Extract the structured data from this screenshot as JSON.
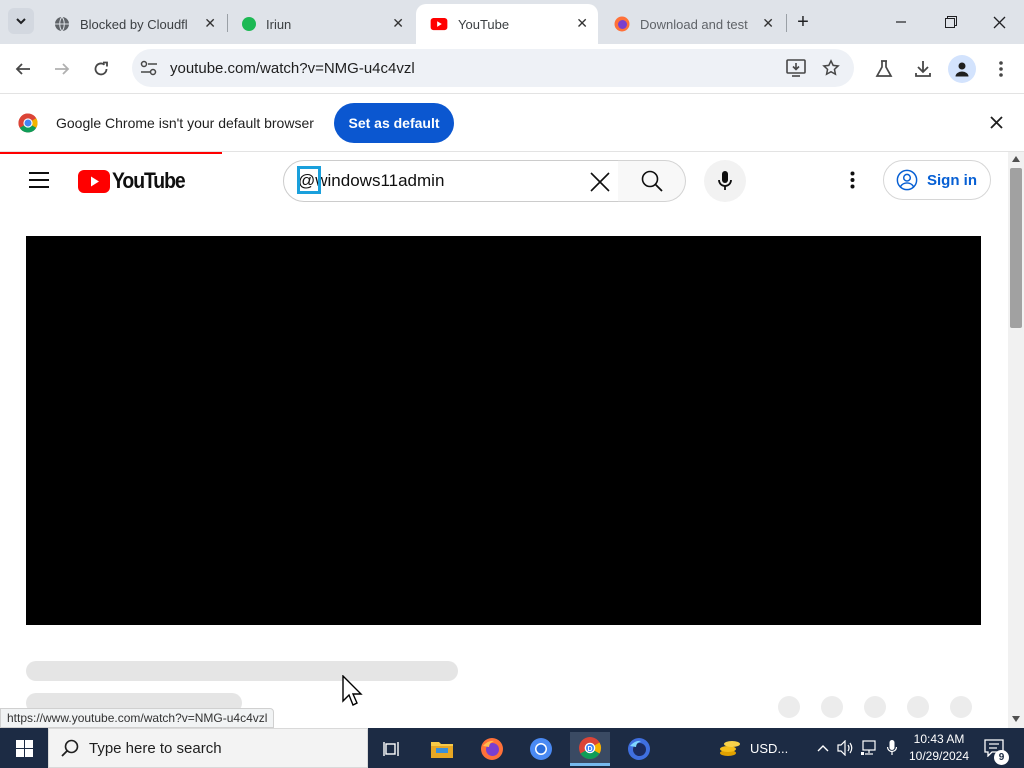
{
  "browser": {
    "tabs": [
      {
        "title": "Blocked by Cloudfl",
        "favicon": "globe-icon",
        "active": false
      },
      {
        "title": "Iriun",
        "favicon": "green-dot-icon",
        "active": false
      },
      {
        "title": "YouTube",
        "favicon": "youtube-icon",
        "active": true
      },
      {
        "title": "Download and test",
        "favicon": "firefox-icon",
        "active": false
      }
    ],
    "url": "youtube.com/watch?v=NMG-u4c4vzl",
    "accent": "#0b57d0"
  },
  "infobar": {
    "message": "Google Chrome isn't your default browser",
    "button": "Set as default"
  },
  "youtube": {
    "logo_text": "YouTube",
    "search_value": "@windows11admin",
    "signin_label": "Sign in",
    "brand_color": "#ff0000"
  },
  "status": {
    "link_url": "https://www.youtube.com/watch?v=NMG-u4c4vzl"
  },
  "taskbar": {
    "search_placeholder": "Type here to search",
    "tray_currency": "USD...",
    "time": "10:43 AM",
    "date": "10/29/2024",
    "notification_count": "9"
  }
}
